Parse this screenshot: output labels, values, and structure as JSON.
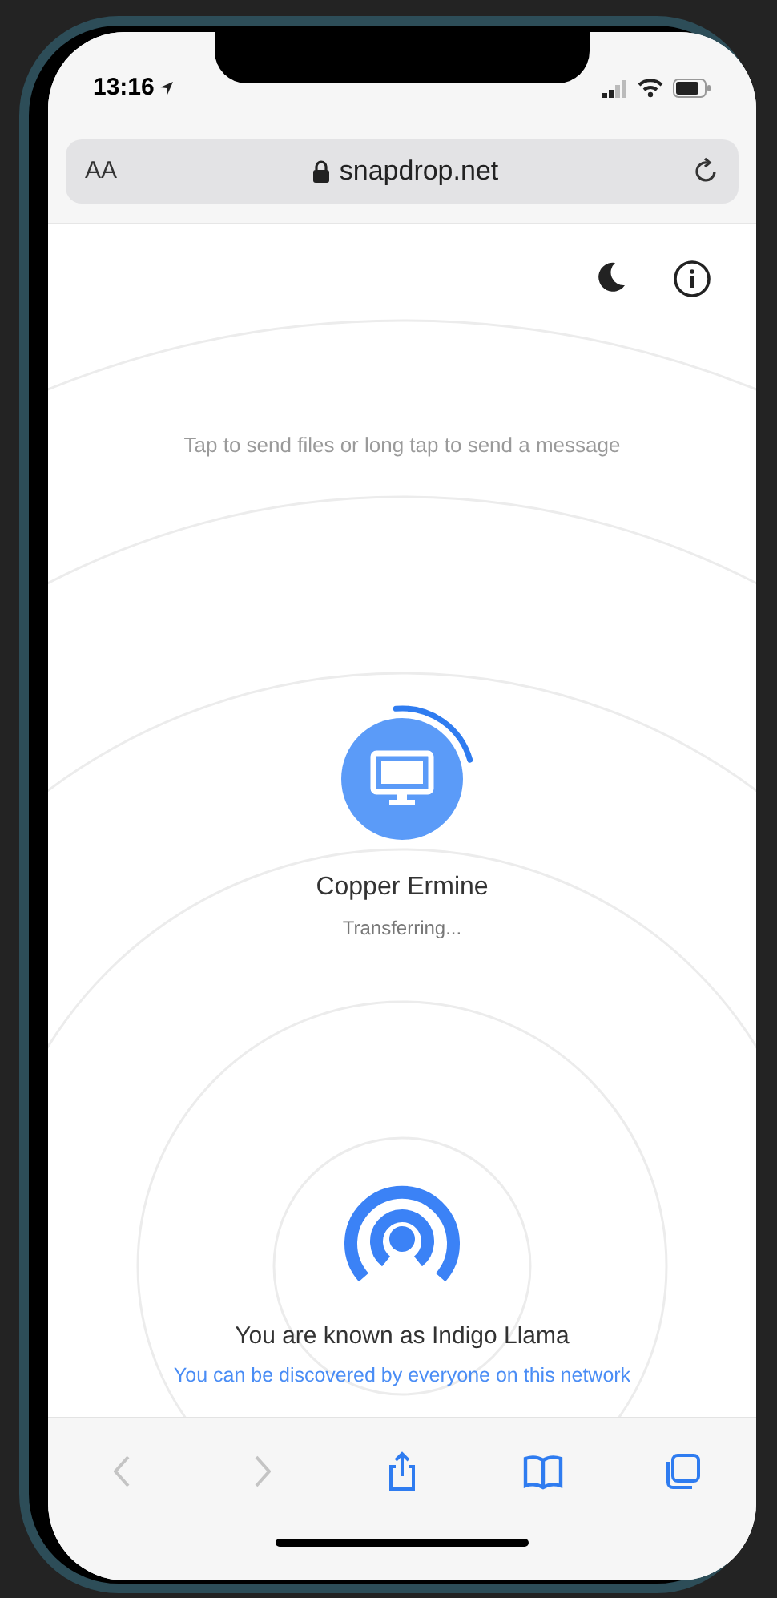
{
  "status_bar": {
    "time": "13:16"
  },
  "address_bar": {
    "text_size_label": "AA",
    "url": "snapdrop.net"
  },
  "hint": "Tap to send files or long tap to send a message",
  "peers": [
    {
      "name": "Copper Ermine",
      "status": "Transferring...",
      "level": 0.22
    }
  ],
  "footer": {
    "known_as": "You are known as Indigo Llama",
    "discoverable": "You can be discovered by everyone on this network"
  },
  "toolbar": [
    {
      "kind": "back",
      "disabled": true
    },
    {
      "kind": "forward",
      "disabled": true
    },
    {
      "kind": "share",
      "disabled": false
    },
    {
      "kind": "bookmarks",
      "disabled": false
    },
    {
      "kind": "tabs",
      "disabled": false
    }
  ]
}
